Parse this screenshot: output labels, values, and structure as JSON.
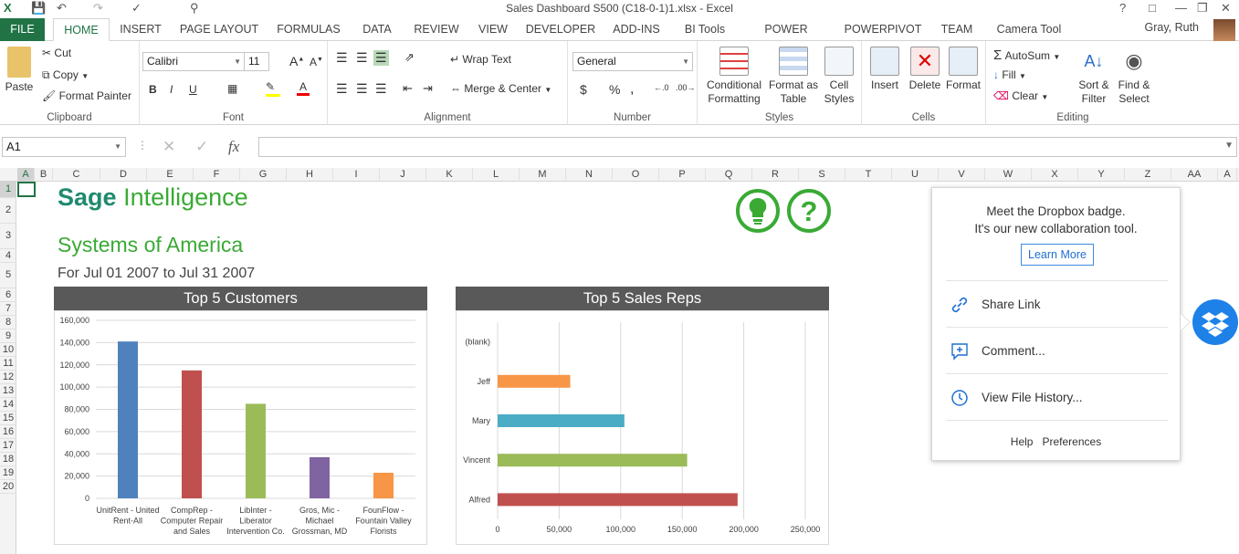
{
  "window": {
    "title": "Sales Dashboard S500 (C18-0-1)1.xlsx - Excel",
    "help": "?",
    "user": "Gray, Ruth"
  },
  "tabs": [
    "FILE",
    "HOME",
    "INSERT",
    "PAGE LAYOUT",
    "FORMULAS",
    "DATA",
    "REVIEW",
    "VIEW",
    "DEVELOPER",
    "ADD-INS",
    "BI Tools",
    "POWER QUERY",
    "POWERPIVOT",
    "TEAM",
    "Camera Tool"
  ],
  "ribbon": {
    "clipboard": {
      "label": "Clipboard",
      "paste": "Paste",
      "cut": "Cut",
      "copy": "Copy",
      "format_painter": "Format Painter"
    },
    "font": {
      "label": "Font",
      "name": "Calibri",
      "size": "11",
      "bold": "B",
      "italic": "I",
      "underline": "U"
    },
    "alignment": {
      "label": "Alignment",
      "wrap": "Wrap Text",
      "merge": "Merge & Center"
    },
    "number": {
      "label": "Number",
      "format": "General",
      "currency": "$",
      "percent": "%",
      "comma": ","
    },
    "styles": {
      "label": "Styles",
      "cond1": "Conditional",
      "cond2": "Formatting",
      "fmt1": "Format as",
      "fmt2": "Table",
      "cell1": "Cell",
      "cell2": "Styles"
    },
    "cells": {
      "label": "Cells",
      "insert": "Insert",
      "delete": "Delete",
      "format": "Format"
    },
    "editing": {
      "label": "Editing",
      "autosum": "AutoSum",
      "fill": "Fill",
      "clear": "Clear",
      "sort1": "Sort &",
      "sort2": "Filter",
      "find1": "Find &",
      "find2": "Select"
    }
  },
  "formula_bar": {
    "name_box": "A1",
    "fx": "fx",
    "value": ""
  },
  "columns": [
    "A",
    "B",
    "C",
    "D",
    "E",
    "F",
    "G",
    "H",
    "I",
    "J",
    "K",
    "L",
    "M",
    "N",
    "O",
    "P",
    "Q",
    "R",
    "S",
    "T",
    "U",
    "V",
    "W",
    "X",
    "Y",
    "Z",
    "AA",
    "A"
  ],
  "rows": [
    "1",
    "2",
    "3",
    "4",
    "5",
    "6",
    "7",
    "8",
    "9",
    "10",
    "11",
    "12",
    "13",
    "14",
    "15",
    "16",
    "17",
    "18",
    "19",
    "20"
  ],
  "sheet": {
    "brand1": "Sage",
    "brand2": "Intelligence",
    "company": "Systems of America",
    "period": "For Jul 01 2007 to Jul 31 2007"
  },
  "chart_data": [
    {
      "type": "bar",
      "title": "Top 5 Customers",
      "categories": [
        "UnitRent - United Rent-All",
        "CompRep - Computer Repair and Sales",
        "LibInter - Liberator Intervention Co.",
        "Gros, Mic - Michael Grossman, MD",
        "FounFlow - Fountain Valley Florists"
      ],
      "category_lines": [
        [
          "UnitRent - United",
          "Rent-All"
        ],
        [
          "CompRep -",
          "Computer Repair",
          "and Sales"
        ],
        [
          "LibInter -",
          "Liberator",
          "Intervention Co."
        ],
        [
          "Gros, Mic -",
          "Michael",
          "Grossman, MD"
        ],
        [
          "FounFlow -",
          "Fountain Valley",
          "Florists"
        ]
      ],
      "values": [
        141000,
        115000,
        85000,
        37000,
        23000
      ],
      "colors": [
        "#4f81bd",
        "#c0504d",
        "#9bbb59",
        "#8064a2",
        "#f79646"
      ],
      "ylim": [
        0,
        160000
      ],
      "yticks": [
        "0",
        "20,000",
        "40,000",
        "60,000",
        "80,000",
        "100,000",
        "120,000",
        "140,000",
        "160,000"
      ],
      "grid": true
    },
    {
      "type": "bar",
      "orientation": "horizontal",
      "title": "Top 5 Sales Reps",
      "categories": [
        "(blank)",
        "Jeff",
        "Mary",
        "Vincent",
        "Alfred"
      ],
      "values": [
        0,
        59000,
        103000,
        154000,
        195000
      ],
      "colors": [
        "#4f81bd",
        "#f79646",
        "#4bacc6",
        "#9bbb59",
        "#c0504d"
      ],
      "xlim": [
        0,
        250000
      ],
      "xticks": [
        "0",
        "50,000",
        "100,000",
        "150,000",
        "200,000",
        "250,000"
      ],
      "grid": true
    }
  ],
  "dropbox": {
    "line1": "Meet the Dropbox badge.",
    "line2": "It's our new collaboration tool.",
    "learn_more": "Learn More",
    "share": "Share Link",
    "comment": "Comment...",
    "history": "View File History...",
    "help": "Help",
    "prefs": "Preferences"
  }
}
